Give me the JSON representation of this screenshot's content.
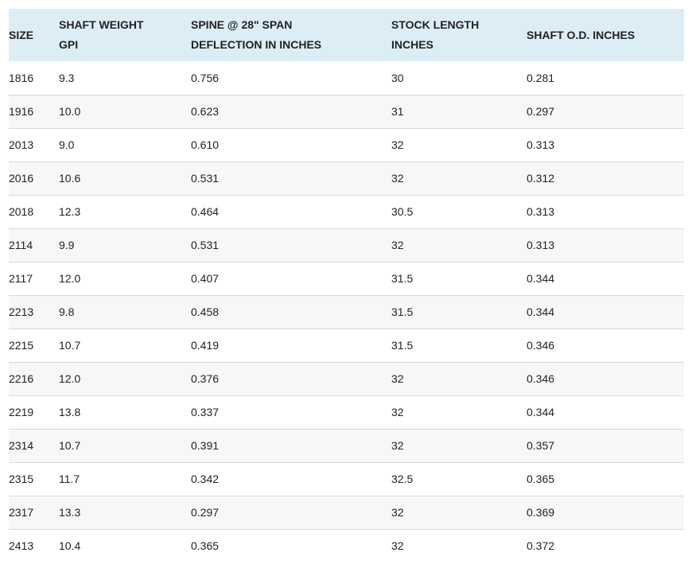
{
  "table": {
    "headers": [
      {
        "line1": "SIZE",
        "line2": ""
      },
      {
        "line1": "SHAFT WEIGHT",
        "line2": "GPI"
      },
      {
        "line1": "SPINE @ 28\" SPAN",
        "line2": "DEFLECTION IN INCHES"
      },
      {
        "line1": "STOCK LENGTH",
        "line2": "INCHES"
      },
      {
        "line1": "SHAFT O.D. INCHES",
        "line2": ""
      }
    ],
    "rows": [
      [
        "1816",
        "9.3",
        "0.756",
        "30",
        "0.281"
      ],
      [
        "1916",
        "10.0",
        "0.623",
        "31",
        "0.297"
      ],
      [
        "2013",
        "9.0",
        "0.610",
        "32",
        "0.313"
      ],
      [
        "2016",
        "10.6",
        "0.531",
        "32",
        "0.312"
      ],
      [
        "2018",
        "12.3",
        "0.464",
        "30.5",
        "0.313"
      ],
      [
        "2114",
        "9.9",
        "0.531",
        "32",
        "0.313"
      ],
      [
        "2117",
        "12.0",
        "0.407",
        "31.5",
        "0.344"
      ],
      [
        "2213",
        "9.8",
        "0.458",
        "31.5",
        "0.344"
      ],
      [
        "2215",
        "10.7",
        "0.419",
        "31.5",
        "0.346"
      ],
      [
        "2216",
        "12.0",
        "0.376",
        "32",
        "0.346"
      ],
      [
        "2219",
        "13.8",
        "0.337",
        "32",
        "0.344"
      ],
      [
        "2314",
        "10.7",
        "0.391",
        "32",
        "0.357"
      ],
      [
        "2315",
        "11.7",
        "0.342",
        "32.5",
        "0.365"
      ],
      [
        "2317",
        "13.3",
        "0.297",
        "32",
        "0.369"
      ],
      [
        "2413",
        "10.4",
        "0.365",
        "32",
        "0.372"
      ]
    ]
  },
  "colors": {
    "header_background": "#dcedf5",
    "alt_row_background": "#f7f7f7",
    "row_divider": "#d9d9d9",
    "text": "#222222"
  }
}
